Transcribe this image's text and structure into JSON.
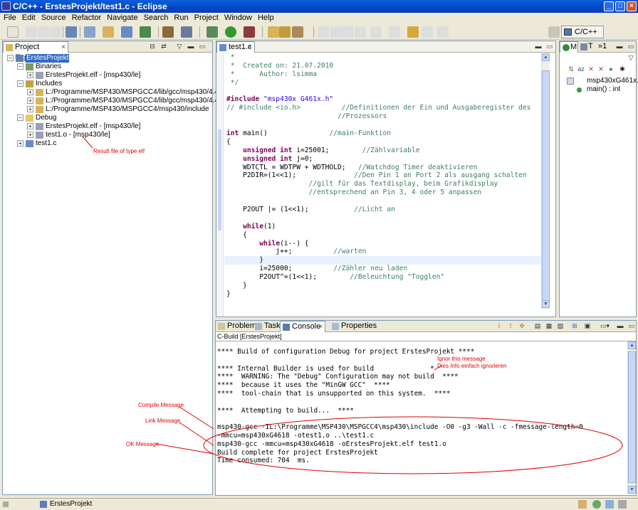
{
  "window": {
    "title": "C/C++ - ErstesProjekt/test1.c - Eclipse"
  },
  "menu": [
    "File",
    "Edit",
    "Source",
    "Refactor",
    "Navigate",
    "Search",
    "Run",
    "Project",
    "Window",
    "Help"
  ],
  "perspective": {
    "label": "C/C++"
  },
  "project_explorer": {
    "tab_label": "Project Explorer",
    "nodes": {
      "project": "ErstesProjekt",
      "binaries": "Binaries",
      "binary_elf": "ErstesProjekt.elf - [msp430/le]",
      "includes": "Includes",
      "inc1": "L:/Programme/MSP430/MSPGCC4/lib/gcc/msp430/4.4.3/include",
      "inc2": "L:/Programme/MSP430/MSPGCC4/lib/gcc/msp430/4.4.3/include-fixed",
      "inc3": "L:/Programme/MSP430/MSPGCC4/msp430/include",
      "debug": "Debug",
      "debug_elf": "ErstesProjekt.elf - [msp430/le]",
      "debug_obj": "test1.o - [msp430/le]",
      "source": "test1.c"
    }
  },
  "editor": {
    "tab_label": "test1.c",
    "lines": [
      [
        [
          "cm",
          " *"
        ]
      ],
      [
        [
          "cm",
          " *  Created on: 21.07.2010"
        ]
      ],
      [
        [
          "cm",
          " *      Author: lsimma"
        ]
      ],
      [
        [
          "cm",
          " */"
        ]
      ],
      [
        [
          "",
          ""
        ]
      ],
      [
        [
          "pp",
          "#include "
        ],
        [
          "st",
          "\"msp430x G461x.h\""
        ]
      ],
      [
        [
          "cm",
          "// #include <io.h>          //Definitionen der Ein und Ausgaberegister des"
        ]
      ],
      [
        [
          "cm",
          "                           //Prozessors"
        ]
      ],
      [
        [
          "",
          ""
        ]
      ],
      [
        [
          "kw",
          "int "
        ],
        [
          "",
          "main()               "
        ],
        [
          "cm",
          "//main-Funktion"
        ]
      ],
      [
        [
          "",
          "{"
        ]
      ],
      [
        [
          "",
          "    "
        ],
        [
          "kw",
          "unsigned int "
        ],
        [
          "",
          "i=25001;        "
        ],
        [
          "cm",
          "//Zählvariable"
        ]
      ],
      [
        [
          "",
          "    "
        ],
        [
          "kw",
          "unsigned int "
        ],
        [
          "",
          "j=0;"
        ]
      ],
      [
        [
          "",
          "    WDTCTL = WDTPW + WDTHOLD;   "
        ],
        [
          "cm",
          "//Watchdog Timer deaktivieren"
        ]
      ],
      [
        [
          "",
          "    P2DIR=(1<<1);              "
        ],
        [
          "cm",
          "//Den Pin 1 an Port 2 als ausgang schalten"
        ]
      ],
      [
        [
          "",
          "                    "
        ],
        [
          "cm",
          "//gilt für das Textdisplay, beim Grafikdisplay"
        ]
      ],
      [
        [
          "",
          "                    "
        ],
        [
          "cm",
          "//entsprechend an Pin 3, 4 oder 5 anpassen"
        ]
      ],
      [
        [
          "",
          ""
        ]
      ],
      [
        [
          "",
          "    P2OUT |= (1<<1);           "
        ],
        [
          "cm",
          "//Licht an"
        ]
      ],
      [
        [
          "",
          ""
        ]
      ],
      [
        [
          "",
          "    "
        ],
        [
          "kw",
          "while"
        ],
        [
          "",
          "(1)"
        ]
      ],
      [
        [
          "",
          "    {"
        ]
      ],
      [
        [
          "",
          "        "
        ],
        [
          "kw",
          "while"
        ],
        [
          "",
          "(i--) {"
        ]
      ],
      [
        [
          "",
          "            j++;          "
        ],
        [
          "cm",
          "//warten"
        ]
      ],
      [
        [
          "",
          "        }"
        ]
      ],
      [
        [
          "",
          "        i=25000;          "
        ],
        [
          "cm",
          "//Zähler neu laden"
        ]
      ],
      [
        [
          "",
          "        P2OUT^=(1<<1);        "
        ],
        [
          "cm",
          "//Beleuchtung \"Togglen\""
        ]
      ],
      [
        [
          "",
          "    }"
        ]
      ],
      [
        [
          "",
          "}"
        ]
      ]
    ]
  },
  "outline": {
    "tabs": [
      "M",
      "T",
      "»1"
    ],
    "items": [
      "msp430xG461x.h",
      "main() : int"
    ]
  },
  "console_view": {
    "tabs": [
      "Problems",
      "Tasks",
      "Console",
      "Properties"
    ],
    "header": "C-Build [ErstesProjekt]",
    "lines": [
      "**** Build of configuration Debug for project ErstesProjekt ****",
      "",
      "**** Internal Builder is used for build              *",
      "****  WARNING: The \"Debug\" Configuration may not build  ****",
      "****  because it uses the \"MinGW GCC\"  ****",
      "****  tool-chain that is unsupported on this system.  ****",
      "",
      "****  Attempting to build...  ****",
      "",
      "msp430-gcc -IL:\\Programme\\MSP430\\MSPGCC4\\msp430\\include -O0 -g3 -Wall -c -fmessage-length=0",
      "-mmcu=msp430xG4618 -otest1.o ..\\test1.c",
      "msp430-gcc -mmcu=msp430xG4618 -oErstesProjekt.elf test1.o",
      "Build complete for project ErstesProjekt",
      "Time consumed: 704  ms."
    ]
  },
  "annotations": {
    "result_file": "Result file of type elf",
    "ignore1": "Ignor this message",
    "ignore2": "Dies Info einfach ignorieren",
    "compile": "Compile Message",
    "link": "Link Message",
    "ok": "OK Message"
  },
  "statusbar": {
    "project": "ErstesProjekt"
  },
  "colors": {
    "comment": "#3f7f5f",
    "keyword": "#7f0055",
    "string": "#2a00ff",
    "annotation": "#e00000",
    "selection": "#316ac5"
  }
}
